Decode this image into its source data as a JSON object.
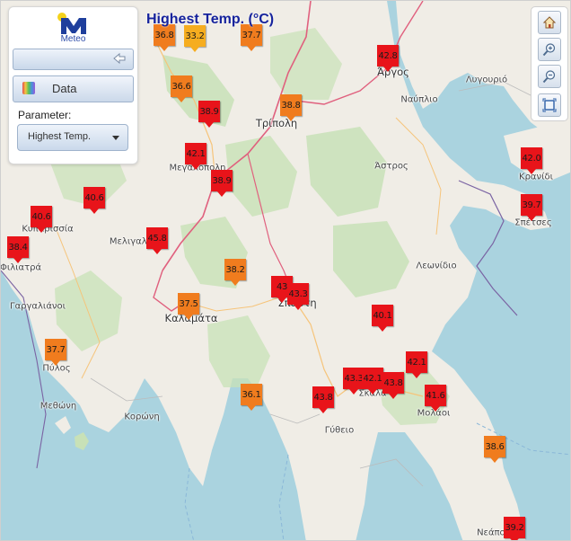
{
  "map_title": "Highest Temp. (°C)",
  "panel": {
    "logo_text": "Meteo",
    "data_label": "Data",
    "parameter_label": "Parameter:",
    "parameter_value": "Highest Temp."
  },
  "colors": {
    "red": "#e8141a",
    "orange": "#f07c1e",
    "amber": "#f6ad1f",
    "sea": "#aad3df",
    "land": "#f0ede6",
    "forest": "#c8e1b7",
    "road": "#e0607e",
    "title": "#16239c"
  },
  "places": [
    "Άργος",
    "Ναύπλιο",
    "Λυγουριό",
    "Τρίπολη",
    "Μεγαλόπολη",
    "Άστρος",
    "Κρανίδι",
    "Σπέτσες",
    "Κυπαρισσία",
    "Μελιγαλάς",
    "Φιλιατρά",
    "Γαργαλιάνοι",
    "Καλαμάτα",
    "Σπάρτη",
    "Λεωνίδιο",
    "Πύλος",
    "Μεθώνη",
    "Κορώνη",
    "Σκάλα",
    "Μολάοι",
    "Γύθειο",
    "Νεάπολη"
  ],
  "stations": [
    {
      "value": "36.8",
      "color": "orange"
    },
    {
      "value": "33.2",
      "color": "amber"
    },
    {
      "value": "37.7",
      "color": "orange"
    },
    {
      "value": "42.8",
      "color": "red"
    },
    {
      "value": "36.6",
      "color": "orange"
    },
    {
      "value": "38.9",
      "color": "red"
    },
    {
      "value": "38.8",
      "color": "orange"
    },
    {
      "value": "42.1",
      "color": "red"
    },
    {
      "value": "38.9",
      "color": "red"
    },
    {
      "value": "40.6",
      "color": "red"
    },
    {
      "value": "40.6",
      "color": "red"
    },
    {
      "value": "38.4",
      "color": "red"
    },
    {
      "value": "45.8",
      "color": "red"
    },
    {
      "value": "42.0",
      "color": "red"
    },
    {
      "value": "39.7",
      "color": "red"
    },
    {
      "value": "38.2",
      "color": "orange"
    },
    {
      "value": "43",
      "color": "red"
    },
    {
      "value": "43.3",
      "color": "red"
    },
    {
      "value": "37.5",
      "color": "orange"
    },
    {
      "value": "40.1",
      "color": "red"
    },
    {
      "value": "37.7",
      "color": "orange"
    },
    {
      "value": "42.1",
      "color": "red"
    },
    {
      "value": "43.3",
      "color": "red"
    },
    {
      "value": "42.1",
      "color": "red"
    },
    {
      "value": "43.8",
      "color": "red"
    },
    {
      "value": "41.6",
      "color": "red"
    },
    {
      "value": "36.1",
      "color": "orange"
    },
    {
      "value": "43.8",
      "color": "red"
    },
    {
      "value": "38.6",
      "color": "orange"
    },
    {
      "value": "39.2",
      "color": "red"
    }
  ]
}
